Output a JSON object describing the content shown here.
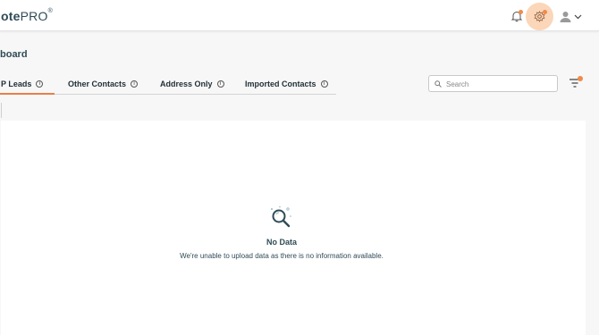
{
  "app": {
    "logo_bold": "ote",
    "logo_light": "PRO",
    "logo_mark": "®"
  },
  "header": {
    "page_title": "board"
  },
  "tabs": [
    {
      "label": "P Leads",
      "active": true
    },
    {
      "label": "Other Contacts",
      "active": false
    },
    {
      "label": "Address Only",
      "active": false
    },
    {
      "label": "Imported Contacts",
      "active": false
    }
  ],
  "search": {
    "placeholder": "Search",
    "value": ""
  },
  "empty_state": {
    "title": "No Data",
    "message": "We're unable to upload data as there is no information available."
  },
  "colors": {
    "accent": "#e8804a",
    "badge": "#f08a4b",
    "gear_highlight": "#fbd6b8",
    "text_primary": "#2f4b56"
  },
  "icons": [
    "bell-icon",
    "gear-icon",
    "user-icon",
    "chevron-down-icon",
    "search-icon",
    "filter-icon",
    "info-icon",
    "no-data-magnifier-icon"
  ]
}
